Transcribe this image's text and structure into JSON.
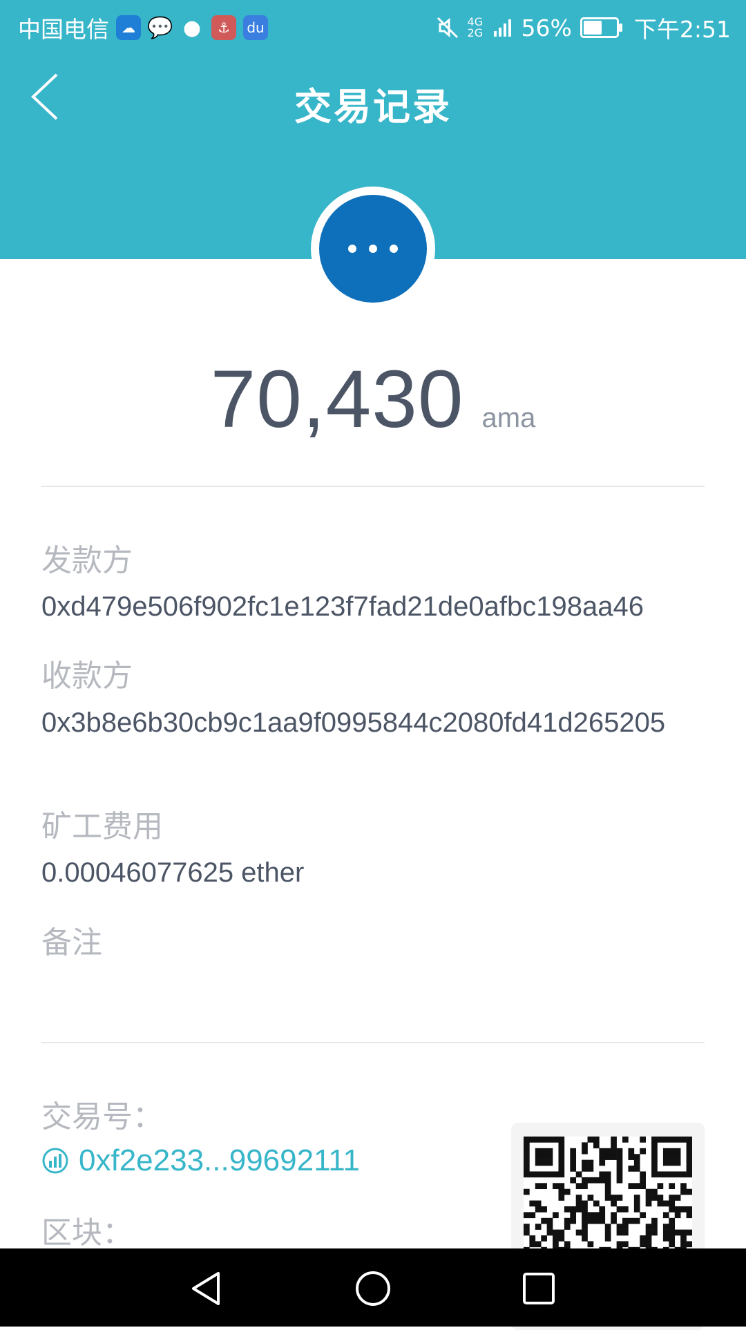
{
  "status_bar": {
    "carrier": "中国电信",
    "network": "4G 2G",
    "battery": "56%",
    "battery_level": 0.56,
    "time": "下午2:51"
  },
  "header": {
    "title": "交易记录"
  },
  "transaction": {
    "amount": "70,430",
    "unit": "ama"
  },
  "fields": {
    "sender_label": "发款方",
    "sender_value": "0xd479e506f902fc1e123f7fad21de0afbc198aa46",
    "receiver_label": "收款方",
    "receiver_value": "0x3b8e6b30cb9c1aa9f0995844c2080fd41d265205",
    "fee_label": "矿工费用",
    "fee_value": "0.00046077625 ether",
    "memo_label": "备注",
    "memo_value": "",
    "txid_label": "交易号：",
    "txid_value": "0xf2e233...99692111",
    "block_label": "区块："
  },
  "colors": {
    "header_bg": "#37b5c9",
    "status_circle": "#0e6fba",
    "link": "#37b5c9"
  },
  "icons": {
    "back": "chevron-left-icon",
    "status": "more-dots-icon",
    "txid": "chart-icon",
    "nav_back": "triangle-back-icon",
    "nav_home": "circle-home-icon",
    "nav_recent": "square-recent-icon"
  }
}
